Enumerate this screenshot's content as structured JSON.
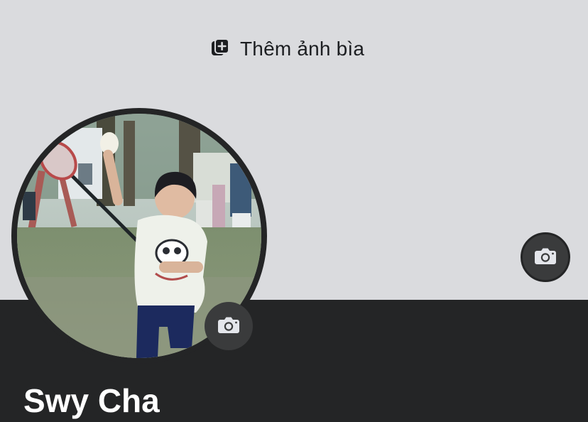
{
  "cover": {
    "add_cover_label": "Thêm ảnh bìa",
    "add_icon": "add-photo-icon",
    "camera_icon": "camera-icon"
  },
  "profile": {
    "name": "Swy Cha",
    "camera_icon": "camera-icon"
  },
  "colors": {
    "cover_background": "#dadbde",
    "page_background": "#242526",
    "camera_button": "#3a3b3c",
    "text_dark": "#1c1e21",
    "text_light": "#ffffff"
  }
}
